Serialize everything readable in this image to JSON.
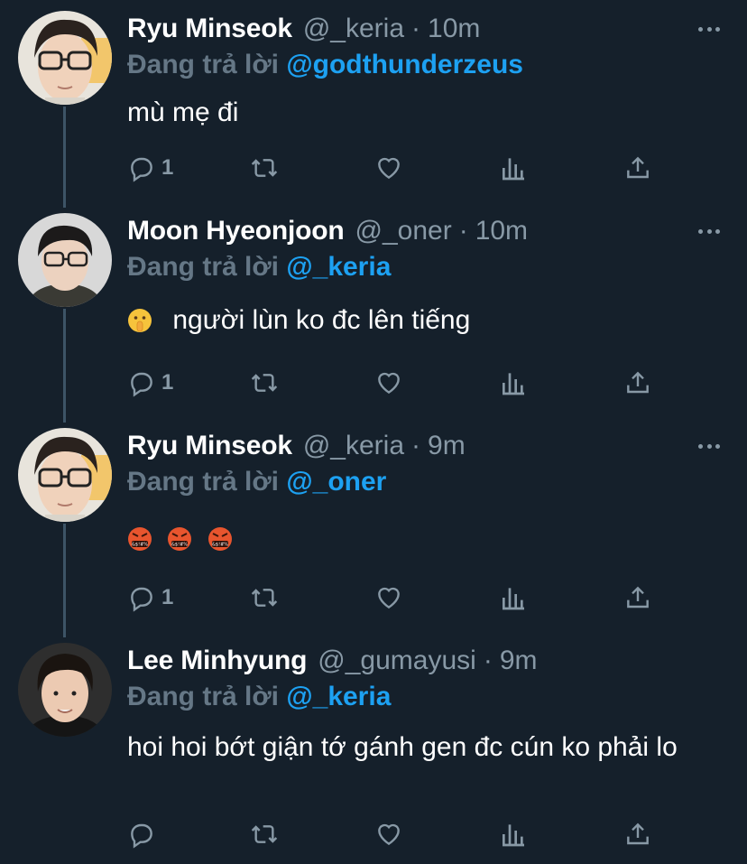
{
  "reply_prefix": "Đang trả lời",
  "tweets": [
    {
      "display_name": "Ryu Minseok",
      "handle": "@_keria",
      "time": "10m",
      "reply_to": "@godthunderzeus",
      "text": "mù mẹ đi",
      "reply_count": "1"
    },
    {
      "display_name": "Moon Hyeonjoon",
      "handle": "@_oner",
      "time": "10m",
      "reply_to": "@_keria",
      "text": "người lùn ko đc lên tiếng",
      "emoji": "shushing-face",
      "reply_count": "1"
    },
    {
      "display_name": "Ryu Minseok",
      "handle": "@_keria",
      "time": "9m",
      "reply_to": "@_oner",
      "text": "",
      "emoji": "face-with-symbols-on-mouth x3",
      "reply_count": "1"
    },
    {
      "display_name": "Lee Minhyung",
      "handle": "@_gumayusi",
      "time": "9m",
      "reply_to": "@_keria",
      "text": "hoi hoi bớt giận tớ gánh gen đc cún ko phải lo",
      "reply_count": ""
    }
  ],
  "colors": {
    "background": "#15202b",
    "link": "#1da1f2",
    "secondary": "#8899a6",
    "thread_line": "#3d5466"
  },
  "icons": [
    "reply-icon",
    "retweet-icon",
    "like-icon",
    "analytics-icon",
    "share-icon",
    "more-icon"
  ]
}
